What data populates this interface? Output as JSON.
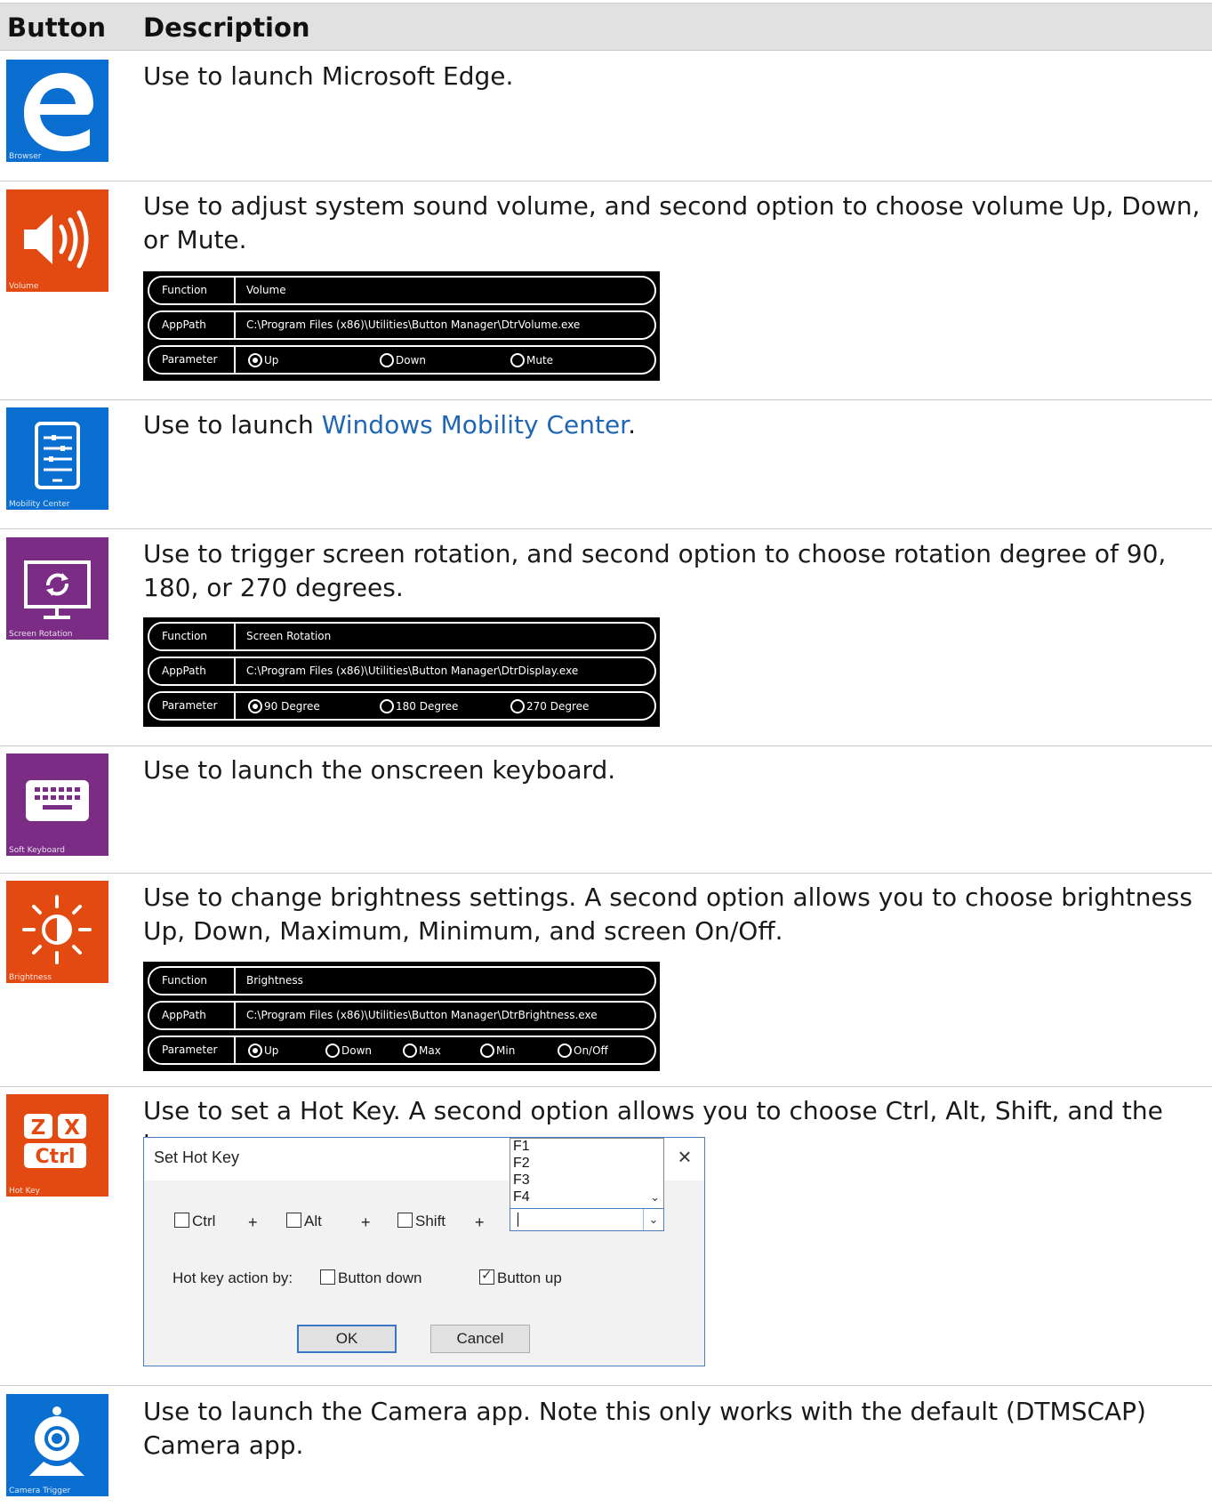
{
  "table": {
    "headers": [
      "Button",
      "Description"
    ],
    "rows": [
      {
        "tile_label": "Browser",
        "icon": "edge-browser-icon",
        "color": "#0a6fd1",
        "description": "Use to launch Microsoft Edge."
      },
      {
        "tile_label": "Volume",
        "icon": "speaker-volume-icon",
        "color": "#e34a12",
        "description": "Use to adjust system sound volume, and second option to choose volume Up, Down, or Mute."
      },
      {
        "tile_label": "Mobility Center",
        "icon": "mobility-center-icon",
        "color": "#0a6fd1",
        "description_prefix": "Use to launch ",
        "description_link": "Windows Mobility Center",
        "description_suffix": "."
      },
      {
        "tile_label": "Screen Rotation",
        "icon": "screen-rotation-icon",
        "color": "#7b2d86",
        "description": "Use to trigger screen rotation, and second option to choose rotation degree of 90, 180, or 270 degrees."
      },
      {
        "tile_label": "Soft Keyboard",
        "icon": "keyboard-icon",
        "color": "#7b2d86",
        "description": "Use to launch the onscreen keyboard."
      },
      {
        "tile_label": "Brightness",
        "icon": "brightness-icon",
        "color": "#e34a12",
        "description": "Use to change brightness settings. A second option allows you to choose brightness Up, Down, Maximum, Minimum, and screen On/Off."
      },
      {
        "tile_label": "Hot Key",
        "icon": "hot-key-icon",
        "color": "#e34a12",
        "description": "Use to set a Hot Key. A second option allows you to choose Ctrl, Alt, Shift, and the key.",
        "icon_keys": [
          "Z",
          "X",
          "Ctrl"
        ]
      },
      {
        "tile_label": "Camera Trigger",
        "icon": "camera-icon",
        "color": "#0a6fd1",
        "description": "Use to launch the Camera app. Note this only works with the default (DTMSCAP) Camera app."
      }
    ]
  },
  "panels": {
    "volume": {
      "function_label": "Function",
      "function_value": "Volume",
      "apppath_label": "AppPath",
      "apppath_value": "C:\\Program Files (x86)\\Utilities\\Button Manager\\DtrVolume.exe",
      "parameter_label": "Parameter",
      "options": [
        "Up",
        "Down",
        "Mute"
      ],
      "selected": "Up"
    },
    "rotation": {
      "function_label": "Function",
      "function_value": "Screen Rotation",
      "apppath_label": "AppPath",
      "apppath_value": "C:\\Program Files (x86)\\Utilities\\Button Manager\\DtrDisplay.exe",
      "parameter_label": "Parameter",
      "options": [
        "90 Degree",
        "180 Degree",
        "270 Degree"
      ],
      "selected": "90 Degree"
    },
    "brightness": {
      "function_label": "Function",
      "function_value": "Brightness",
      "apppath_label": "AppPath",
      "apppath_value": "C:\\Program Files (x86)\\Utilities\\Button Manager\\DtrBrightness.exe",
      "parameter_label": "Parameter",
      "options": [
        "Up",
        "Down",
        "Max",
        "Min",
        "On/Off"
      ],
      "selected": "Up"
    }
  },
  "hotkey_dialog": {
    "title": "Set Hot Key",
    "close": "×",
    "ctrl": "Ctrl",
    "alt": "Alt",
    "shift": "Shift",
    "plus": "+",
    "key_value": "",
    "key_options": [
      "F1",
      "F2",
      "F3",
      "F4"
    ],
    "action_label": "Hot key action by:",
    "button_down": "Button down",
    "button_down_checked": false,
    "button_up": "Button up",
    "button_up_checked": true,
    "ok": "OK",
    "cancel": "Cancel"
  }
}
